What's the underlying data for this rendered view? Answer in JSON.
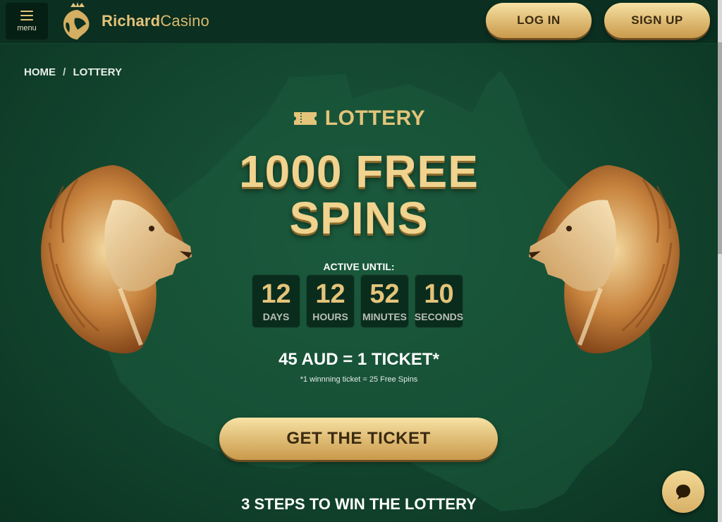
{
  "header": {
    "menu_label": "menu",
    "brand_bold": "Richard",
    "brand_light": "Casino",
    "login_label": "LOG IN",
    "signup_label": "SIGN UP"
  },
  "breadcrumb": {
    "home": "HOME",
    "separator": "/",
    "current": "LOTTERY"
  },
  "promo": {
    "section_title": "LOTTERY",
    "headline_line1": "1000 FREE",
    "headline_line2": "SPINS",
    "active_until_label": "ACTIVE UNTIL:",
    "countdown": [
      {
        "value": "12",
        "unit": "DAYS"
      },
      {
        "value": "12",
        "unit": "HOURS"
      },
      {
        "value": "52",
        "unit": "MINUTES"
      },
      {
        "value": "10",
        "unit": "SECONDS"
      }
    ],
    "price": "45 AUD = 1 TICKET*",
    "price_note": "*1 winnning ticket = 25 Free Spins",
    "cta_label": "GET THE TICKET",
    "steps_title": "3 STEPS TO WIN THE LOTTERY"
  },
  "icons": {
    "menu": "hamburger-icon",
    "logo": "lion-crown-icon",
    "ticket": "ticket-icon",
    "chat": "chat-bubble-icon"
  },
  "colors": {
    "background": "#154a32",
    "header": "#0b2f20",
    "gold": "#e4c47a",
    "button_text": "#3a2a10"
  }
}
